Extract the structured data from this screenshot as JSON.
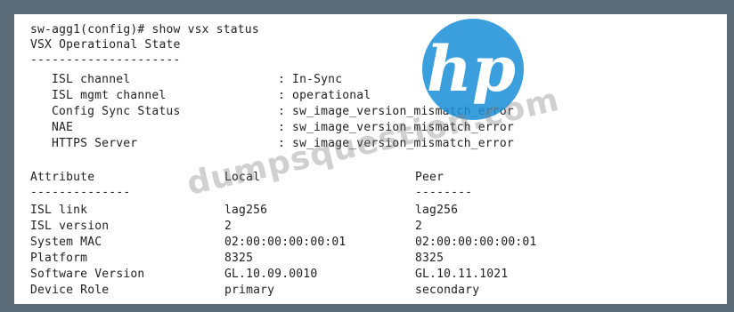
{
  "command_line": "sw-agg1(config)# show vsx status",
  "section_title": "VSX Operational State",
  "separator": "---------------------",
  "status_rows": [
    {
      "label": "ISL channel",
      "value": ": In-Sync"
    },
    {
      "label": "ISL mgmt channel",
      "value": ": operational"
    },
    {
      "label": "Config Sync Status",
      "value": ": sw_image_version_mismatch_error"
    },
    {
      "label": "NAE",
      "value": ": sw_image_version_mismatch_error"
    },
    {
      "label": "HTTPS Server",
      "value": ": sw_image_version_mismatch_error"
    }
  ],
  "table": {
    "headers": {
      "attribute": "Attribute",
      "local": "Local",
      "peer": "Peer"
    },
    "separators": {
      "attribute": "--------------",
      "peer": "--------"
    },
    "rows": [
      {
        "attribute": "ISL link",
        "local": "lag256",
        "peer": "lag256"
      },
      {
        "attribute": "ISL version",
        "local": "2",
        "peer": "2"
      },
      {
        "attribute": "System MAC",
        "local": "02:00:00:00:00:01",
        "peer": "02:00:00:00:00:01"
      },
      {
        "attribute": "Platform",
        "local": "8325",
        "peer": "8325"
      },
      {
        "attribute": "Software Version",
        "local": "GL.10.09.0010",
        "peer": "GL.10.11.1021"
      },
      {
        "attribute": "Device Role",
        "local": "primary",
        "peer": "secondary"
      }
    ]
  },
  "watermark": "dumpsquestion.com",
  "logo": {
    "text": "hp",
    "color": "#1b8fd8"
  },
  "colors": {
    "frame": "#5b6b77",
    "terminal_bg": "#ffffff",
    "text": "#222222"
  }
}
